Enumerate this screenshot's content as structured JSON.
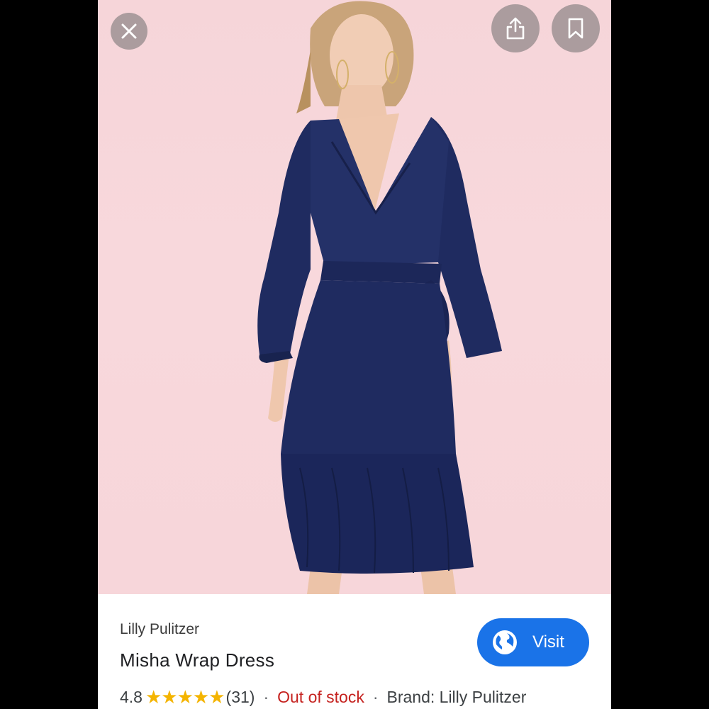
{
  "toolbar": {
    "close_icon": "close-icon",
    "share_icon": "share-icon",
    "save_icon": "bookmark-icon"
  },
  "product": {
    "merchant": "Lilly Pulitzer",
    "title": "Misha Wrap Dress",
    "rating": "4.8",
    "stars": "★★★★★",
    "review_count": "(31)",
    "stock_status": "Out of stock",
    "brand": "Brand: Lilly Pulitzer",
    "separator": "·"
  },
  "visit": {
    "label": "Visit",
    "icon": "globe-icon"
  },
  "colors": {
    "accent": "#1a73e8",
    "stars": "#f4b400",
    "out_of_stock": "#c5221f",
    "background_pink": "#f7d6da",
    "dress_navy": "#1e2a5e"
  }
}
